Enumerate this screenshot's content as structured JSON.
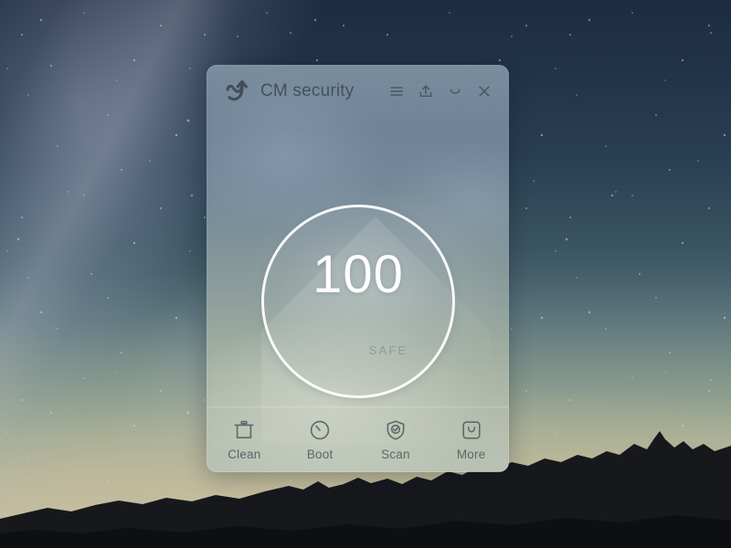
{
  "window": {
    "title": "CM security",
    "logo_icon": "cm-swoosh-arrow-logo"
  },
  "header": {
    "actions": [
      {
        "name": "menu",
        "icon": "hamburger-menu-icon",
        "label": "Menu"
      },
      {
        "name": "share",
        "icon": "upload-share-icon",
        "label": "Share"
      },
      {
        "name": "minimize",
        "icon": "minimize-icon",
        "label": "Minimize"
      },
      {
        "name": "close",
        "icon": "close-icon",
        "label": "Close"
      }
    ]
  },
  "score": {
    "value": "100",
    "status": "SAFE",
    "ring_color": "#ffffff",
    "value_color": "#ffffff",
    "status_color": "#8d9aa0"
  },
  "bottom_nav": {
    "items": [
      {
        "label": "Clean",
        "icon": "trash-can-icon"
      },
      {
        "label": "Boot",
        "icon": "speedometer-icon"
      },
      {
        "label": "Scan",
        "icon": "shield-check-icon"
      },
      {
        "label": "More",
        "icon": "app-bag-icon"
      }
    ]
  },
  "colors": {
    "title_text": "#43505c",
    "nav_text": "#5a6868",
    "panel_tint_top": "#6c8195",
    "panel_tint_bottom": "#b9c2b4",
    "sky_top": "#1d2c41",
    "horizon_glow": "#cdc2a2"
  }
}
